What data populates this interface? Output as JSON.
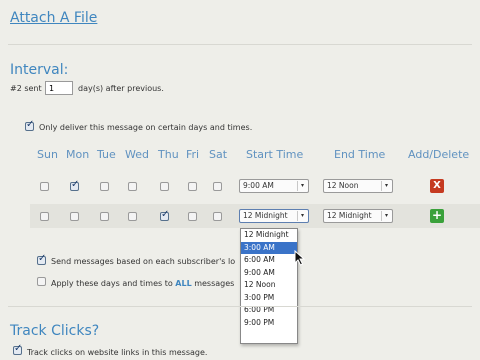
{
  "attach": {
    "label": "Attach A File"
  },
  "interval": {
    "title": "Interval:",
    "prefix": "#2 sent",
    "days_value": "1",
    "suffix": "day(s) after previous."
  },
  "deliver": {
    "only_certain_days_label": "Only deliver this message on certain days and times."
  },
  "schedule": {
    "headers": {
      "days": [
        "Sun",
        "Mon",
        "Tue",
        "Wed",
        "Thu",
        "Fri",
        "Sat"
      ],
      "start_time": "Start Time",
      "end_time": "End Time",
      "add_delete": "Add/Delete"
    },
    "rows": [
      {
        "checked_days": [
          "Mon"
        ],
        "start": "9:00 AM",
        "end": "12 Noon",
        "action": "delete",
        "action_symbol": "X"
      },
      {
        "checked_days": [
          "Thu"
        ],
        "start": "12 Midnight",
        "end": "12 Midnight",
        "action": "add",
        "action_symbol": "+"
      }
    ]
  },
  "dropdown": {
    "options": [
      "12 Midnight",
      "3:00 AM",
      "6:00 AM",
      "9:00 AM",
      "12 Noon",
      "3:00 PM",
      "6:00 PM",
      "9:00 PM"
    ],
    "highlighted": "3:00 AM"
  },
  "options": {
    "timezone_label": "Send messages based on each subscriber's lo",
    "apply_prefix": "Apply these days and times to",
    "apply_all": "ALL",
    "apply_suffix": "messages"
  },
  "track": {
    "title": "Track Clicks?",
    "links_label": "Track clicks on website links in this message."
  },
  "colors": {
    "link": "#3f86bf",
    "delete": "#c53a20",
    "add": "#3aa13a",
    "highlight": "#3a73c8"
  }
}
